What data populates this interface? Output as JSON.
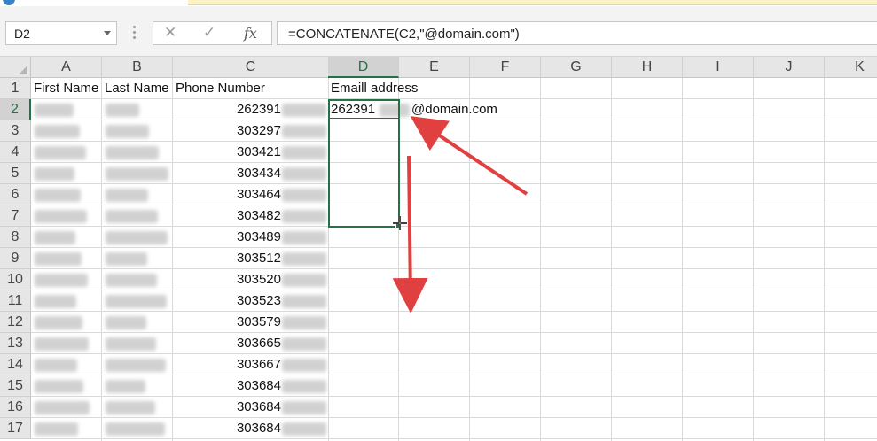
{
  "namebox": {
    "value": "D2"
  },
  "formula_bar": {
    "cancel_glyph": "✕",
    "enter_glyph": "✓",
    "fx_label": "fx",
    "formula": "=CONCATENATE(C2,\"@domain.com\")"
  },
  "columns": [
    "A",
    "B",
    "C",
    "D",
    "E",
    "F",
    "G",
    "H",
    "I",
    "J",
    "K"
  ],
  "rows": [
    "1",
    "2",
    "3",
    "4",
    "5",
    "6",
    "7",
    "8",
    "9",
    "10",
    "11",
    "12",
    "13",
    "14",
    "15",
    "16",
    "17"
  ],
  "headers": {
    "a": "First Name",
    "b": "Last Name",
    "c": "Phone Number",
    "d": "Emaill address"
  },
  "phone_values": [
    "262391",
    "303297",
    "303421",
    "303434",
    "303464",
    "303482",
    "303489",
    "303512",
    "303520",
    "303523",
    "303579",
    "303665",
    "303667",
    "303684",
    "303684",
    "303684"
  ],
  "d2_value_prefix": "262391",
  "d2_value_suffix": "@domain.com",
  "colors": {
    "excel_green": "#217346",
    "annotation_red": "#e0403f",
    "header_gray": "#e6e6e6"
  }
}
